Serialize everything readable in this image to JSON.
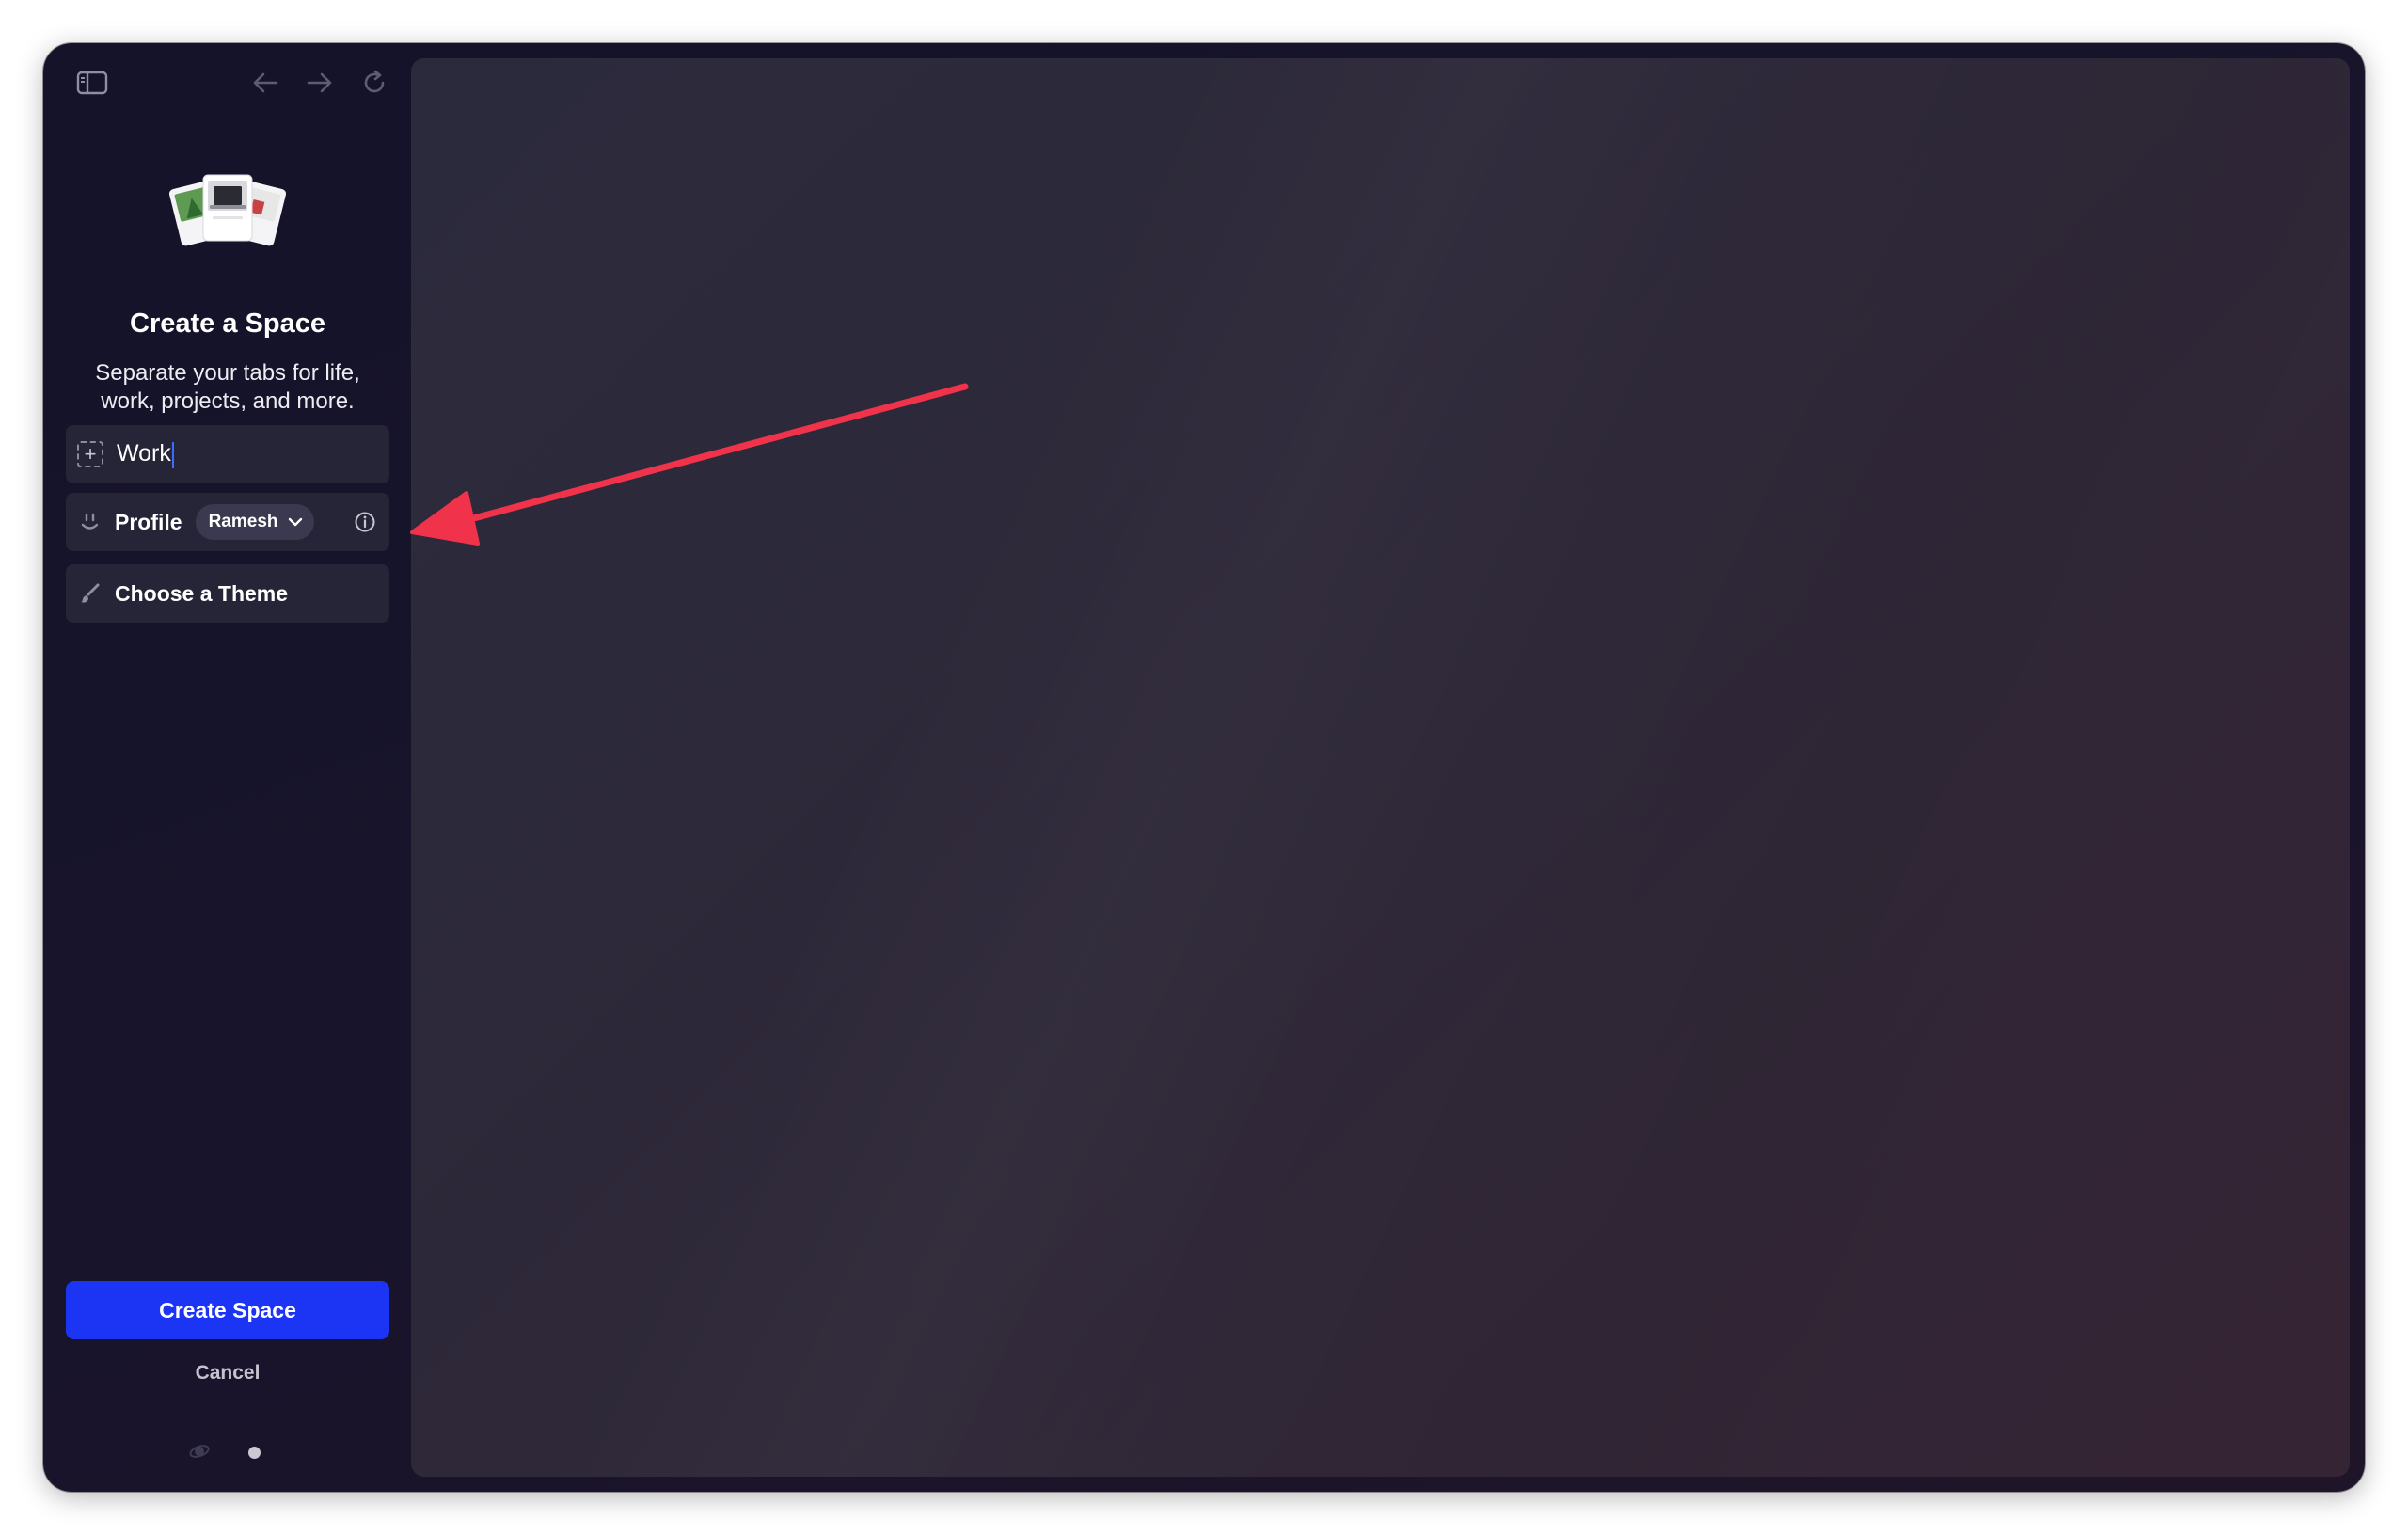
{
  "toolbar": {
    "sidebar_toggle_icon": "sidebar-toggle-icon",
    "back_icon": "arrow-left-icon",
    "forward_icon": "arrow-right-icon",
    "reload_icon": "reload-icon"
  },
  "create_space": {
    "title": "Create a Space",
    "subtitle_line1": "Separate your tabs for life,",
    "subtitle_line2": "work, projects, and more.",
    "name_field": {
      "value": "Work",
      "icon": "plus-dashed-icon"
    },
    "profile": {
      "label": "Profile",
      "selected": "Ramesh",
      "icon": "smile-icon",
      "info_icon": "info-icon"
    },
    "theme": {
      "label": "Choose a Theme",
      "icon": "paintbrush-icon"
    },
    "create_button": "Create Space",
    "cancel": "Cancel"
  },
  "colors": {
    "accent": "#1c35f5",
    "annotation_arrow": "#f0334b"
  }
}
